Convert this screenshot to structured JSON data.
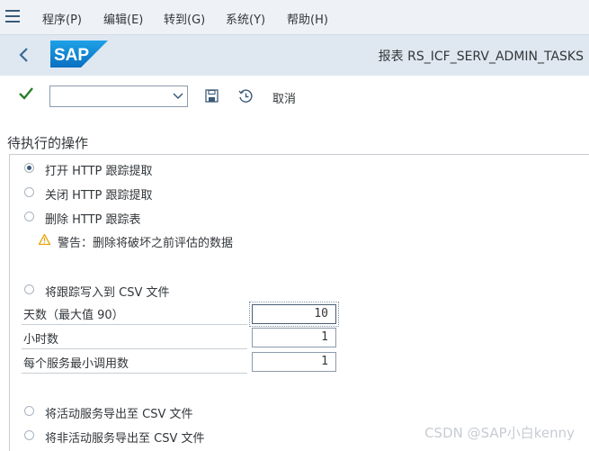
{
  "menu": {
    "items": [
      {
        "label": "程序(P)"
      },
      {
        "label": "编辑(E)"
      },
      {
        "label": "转到(G)"
      },
      {
        "label": "系统(Y)"
      },
      {
        "label": "帮助(H)"
      }
    ]
  },
  "header": {
    "logo_text": "SAP",
    "report_title": "报表 RS_ICF_SERV_ADMIN_TASKS"
  },
  "toolbar": {
    "variant_value": "",
    "cancel_label": "取消"
  },
  "section": {
    "title": "待执行的操作"
  },
  "options": [
    {
      "label": "打开 HTTP 跟踪提取",
      "checked": true
    },
    {
      "label": "关闭 HTTP 跟踪提取",
      "checked": false
    },
    {
      "label": "删除 HTTP 跟踪表",
      "checked": false
    }
  ],
  "warning": {
    "text": "警告：删除将破坏之前评估的数据"
  },
  "csv_option": {
    "label": "将跟踪写入到 CSV 文件",
    "checked": false
  },
  "fields": [
    {
      "label": "天数（最大值 90）",
      "value": "10"
    },
    {
      "label": "小时数",
      "value": "1"
    },
    {
      "label": "每个服务最小调用数",
      "value": "1"
    }
  ],
  "export_options": [
    {
      "label": "将活动服务导出至 CSV 文件",
      "checked": false
    },
    {
      "label": "将非活动服务导出至 CSV 文件",
      "checked": false
    }
  ],
  "watermark": "CSDN @SAP小白kenny",
  "colors": {
    "menubar_bg": "#eef2f6",
    "shell_bg": "#dfe8f0",
    "sap_blue": "#1a8bd8",
    "check_green": "#2b7d2b",
    "warning_amber": "#e9a100"
  }
}
